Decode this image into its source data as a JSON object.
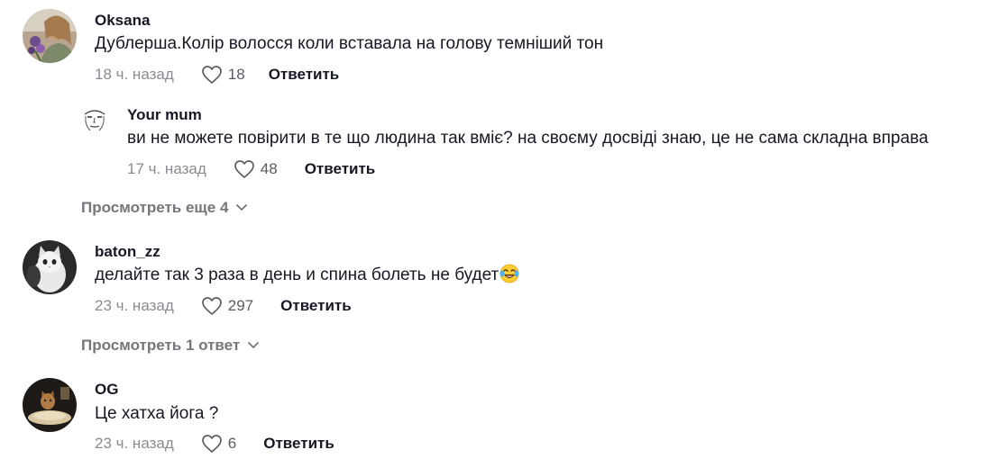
{
  "comments": [
    {
      "username": "Oksana",
      "text": "Дублерша.Колір волосся коли вставала на голову темніший тон",
      "time": "18 ч. назад",
      "likes": "18",
      "reply_label": "Ответить",
      "replies": [
        {
          "username": "Your mum",
          "text": "ви не можете повірити в те що людина так вміє? на своєму досвіді знаю, це не сама складна вправа",
          "time": "17 ч. назад",
          "likes": "48",
          "reply_label": "Ответить"
        }
      ],
      "more_replies": "Просмотреть еще 4"
    },
    {
      "username": "baton_zz",
      "text": "делайте так 3 раза в день и спина болеть не будет",
      "emoji": "face-with-tears-of-joy",
      "time": "23 ч. назад",
      "likes": "297",
      "reply_label": "Ответить",
      "more_replies": "Просмотреть 1 ответ"
    },
    {
      "username": "OG",
      "text": "Це хатха йога ?",
      "time": "23 ч. назад",
      "likes": "6",
      "reply_label": "Ответить"
    }
  ]
}
